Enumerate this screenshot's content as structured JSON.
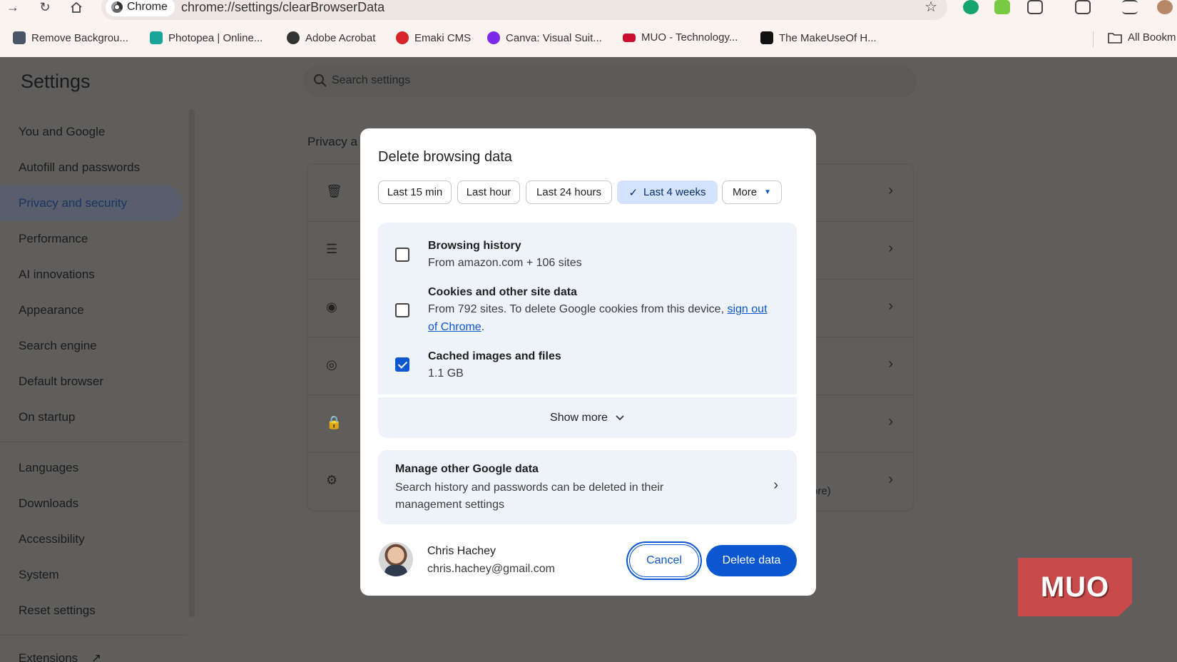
{
  "browser": {
    "chip_label": "Chrome",
    "url": "chrome://settings/clearBrowserData",
    "bookmarks": [
      {
        "label": "Remove Backgrou...",
        "color": "#4a5568"
      },
      {
        "label": "Photopea | Online...",
        "color": "#18a497"
      },
      {
        "label": "Adobe Acrobat",
        "color": "#333333"
      },
      {
        "label": "Emaki CMS",
        "color": "#d8232a"
      },
      {
        "label": "Canva: Visual Suit...",
        "color": "#7d2ae8"
      },
      {
        "label": "MUO - Technology...",
        "color": "#c8102e"
      },
      {
        "label": "The MakeUseOf H...",
        "color": "#111111"
      }
    ],
    "all_bookmarks_label": "All Bookm"
  },
  "settings": {
    "title": "Settings",
    "search_placeholder": "Search settings",
    "nav": [
      "You and Google",
      "Autofill and passwords",
      "Privacy and security",
      "Performance",
      "AI innovations",
      "Appearance",
      "Search engine",
      "Default browser",
      "On startup",
      "Languages",
      "Downloads",
      "Accessibility",
      "System",
      "Reset settings",
      "Extensions"
    ],
    "section_heading": "Privacy a",
    "card_more_text": "ore)"
  },
  "dialog": {
    "title": "Delete browsing data",
    "ranges": [
      "Last 15 min",
      "Last hour",
      "Last 24 hours",
      "Last 4 weeks",
      "More"
    ],
    "selected_range": "Last 4 weeks",
    "options": [
      {
        "title": "Browsing history",
        "subtitle": "From amazon.com + 106 sites",
        "checked": false
      },
      {
        "title": "Cookies and other site data",
        "subtitle": "From 792 sites. To delete Google cookies from this device,",
        "link": "sign out of Chrome",
        "checked": false
      },
      {
        "title": "Cached images and files",
        "subtitle": "1.1 GB",
        "checked": true
      }
    ],
    "show_more": "Show more",
    "manage": {
      "title": "Manage other Google data",
      "subtitle": "Search history and passwords can be deleted in their management settings"
    },
    "user": {
      "name": "Chris Hachey",
      "email": "chris.hachey@gmail.com"
    },
    "cancel_label": "Cancel",
    "delete_label": "Delete data"
  },
  "watermark": "MUO",
  "colors": {
    "accent": "#0b57d0",
    "selected_chip": "#d3e3fd",
    "panel": "#eef2f9"
  }
}
